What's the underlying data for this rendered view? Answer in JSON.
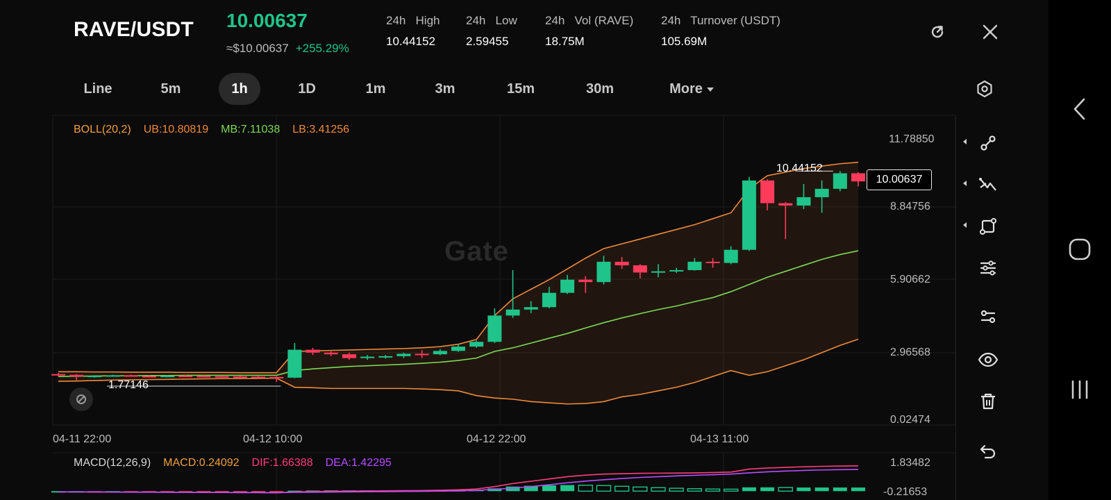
{
  "header": {
    "pair": "RAVE/USDT",
    "price": "10.00637",
    "usd_price": "≈$10.00637",
    "change": "+255.29%",
    "stats": [
      {
        "label": "24h   High",
        "value": "10.44152"
      },
      {
        "label": "24h   Low",
        "value": "2.59455"
      },
      {
        "label": "24h   Vol (RAVE)",
        "value": "18.75M"
      },
      {
        "label": "24h   Turnover (USDT)",
        "value": "105.69M"
      }
    ],
    "icons": [
      "refresh-icon",
      "close-icon"
    ]
  },
  "intervals": {
    "items": [
      "Line",
      "5m",
      "1h",
      "1D",
      "1m",
      "3m",
      "15m",
      "30m",
      "More"
    ],
    "active": "1h",
    "settings_icon": "settings-hex-icon"
  },
  "boll": {
    "label": "BOLL(20,2)",
    "ub": "UB:10.80819",
    "mb": "MB:7.11038",
    "lb": "LB:3.41256",
    "colors": {
      "label": "#f0a040",
      "ub": "#f08a3c",
      "mb": "#7ed957",
      "lb": "#f08a3c"
    }
  },
  "price_axis": [
    "11.78850",
    "8.84756",
    "5.90662",
    "2.96568",
    "0.02474"
  ],
  "time_axis": [
    "04-11 22:00",
    "04-12 10:00",
    "04-12 22:00",
    "04-13 11:00"
  ],
  "markers": {
    "high": "10.44152",
    "low": "1.77146",
    "last": "10.00637"
  },
  "watermark": "Gate",
  "macd": {
    "label": "MACD(12,26,9)",
    "macd": "MACD:0.24092",
    "dif": "DIF:1.66388",
    "dea": "DEA:1.42295",
    "axis": [
      "1.83482",
      "-0.21653"
    ],
    "colors": {
      "macd": "#f0a040",
      "dif": "#ff3d7f",
      "dea": "#b84dff"
    }
  },
  "toolbar": {
    "tools": [
      "trend-line-icon",
      "crossing-lines-icon",
      "shape-icon",
      "settings-sliders-icon",
      "indicator-icon",
      "eye-icon",
      "trash-icon",
      "undo-icon"
    ]
  },
  "system_nav": [
    "back-icon",
    "home-icon",
    "recents-icon"
  ],
  "colors": {
    "up": "#1fc48a",
    "down": "#ff3b5c",
    "bg": "#0b0b0b"
  },
  "chart_data": {
    "type": "candlestick",
    "interval": "1h",
    "y_range": [
      0.02474,
      11.7885
    ],
    "candles": [
      {
        "o": 1.95,
        "h": 2.0,
        "l": 1.85,
        "c": 1.92
      },
      {
        "o": 1.92,
        "h": 1.95,
        "l": 1.7,
        "c": 1.85
      },
      {
        "o": 1.85,
        "h": 1.9,
        "l": 1.8,
        "c": 1.88
      },
      {
        "o": 1.88,
        "h": 1.92,
        "l": 1.84,
        "c": 1.9
      },
      {
        "o": 1.9,
        "h": 1.93,
        "l": 1.85,
        "c": 1.87
      },
      {
        "o": 1.87,
        "h": 1.9,
        "l": 1.85,
        "c": 1.86
      },
      {
        "o": 1.86,
        "h": 1.9,
        "l": 1.82,
        "c": 1.88
      },
      {
        "o": 1.88,
        "h": 1.92,
        "l": 1.85,
        "c": 1.87
      },
      {
        "o": 1.87,
        "h": 1.9,
        "l": 1.82,
        "c": 1.86
      },
      {
        "o": 1.86,
        "h": 1.88,
        "l": 1.84,
        "c": 1.85
      },
      {
        "o": 1.85,
        "h": 1.88,
        "l": 1.82,
        "c": 1.84
      },
      {
        "o": 1.84,
        "h": 1.87,
        "l": 1.8,
        "c": 1.83
      },
      {
        "o": 1.83,
        "h": 1.86,
        "l": 1.62,
        "c": 1.8
      },
      {
        "o": 1.8,
        "h": 3.25,
        "l": 1.78,
        "c": 2.97
      },
      {
        "o": 2.97,
        "h": 3.05,
        "l": 2.75,
        "c": 2.85
      },
      {
        "o": 2.85,
        "h": 2.9,
        "l": 2.7,
        "c": 2.78
      },
      {
        "o": 2.78,
        "h": 2.85,
        "l": 2.55,
        "c": 2.62
      },
      {
        "o": 2.62,
        "h": 2.75,
        "l": 2.55,
        "c": 2.68
      },
      {
        "o": 2.68,
        "h": 2.75,
        "l": 2.6,
        "c": 2.7
      },
      {
        "o": 2.7,
        "h": 2.85,
        "l": 2.62,
        "c": 2.8
      },
      {
        "o": 2.8,
        "h": 2.95,
        "l": 2.62,
        "c": 2.78
      },
      {
        "o": 2.78,
        "h": 3.0,
        "l": 2.74,
        "c": 2.92
      },
      {
        "o": 2.92,
        "h": 3.2,
        "l": 2.88,
        "c": 3.1
      },
      {
        "o": 3.1,
        "h": 3.35,
        "l": 3.05,
        "c": 3.3
      },
      {
        "o": 3.3,
        "h": 4.7,
        "l": 3.25,
        "c": 4.4
      },
      {
        "o": 4.4,
        "h": 6.3,
        "l": 4.3,
        "c": 4.65
      },
      {
        "o": 4.65,
        "h": 5.0,
        "l": 4.5,
        "c": 4.75
      },
      {
        "o": 4.75,
        "h": 5.6,
        "l": 4.7,
        "c": 5.35
      },
      {
        "o": 5.35,
        "h": 6.1,
        "l": 5.3,
        "c": 5.9
      },
      {
        "o": 5.9,
        "h": 6.05,
        "l": 5.35,
        "c": 5.8
      },
      {
        "o": 5.8,
        "h": 6.9,
        "l": 5.7,
        "c": 6.65
      },
      {
        "o": 6.65,
        "h": 6.85,
        "l": 6.35,
        "c": 6.5
      },
      {
        "o": 6.5,
        "h": 6.55,
        "l": 5.95,
        "c": 6.2
      },
      {
        "o": 6.2,
        "h": 6.55,
        "l": 6.0,
        "c": 6.25
      },
      {
        "o": 6.25,
        "h": 6.4,
        "l": 6.18,
        "c": 6.3
      },
      {
        "o": 6.3,
        "h": 6.8,
        "l": 6.28,
        "c": 6.65
      },
      {
        "o": 6.65,
        "h": 6.8,
        "l": 6.4,
        "c": 6.6
      },
      {
        "o": 6.6,
        "h": 7.3,
        "l": 6.55,
        "c": 7.15
      },
      {
        "o": 7.15,
        "h": 10.2,
        "l": 7.1,
        "c": 10.05
      },
      {
        "o": 10.05,
        "h": 10.1,
        "l": 8.8,
        "c": 9.1
      },
      {
        "o": 9.1,
        "h": 9.15,
        "l": 7.6,
        "c": 9.0
      },
      {
        "o": 9.0,
        "h": 9.9,
        "l": 8.85,
        "c": 9.35
      },
      {
        "o": 9.35,
        "h": 10.05,
        "l": 8.7,
        "c": 9.7
      },
      {
        "o": 9.7,
        "h": 10.44,
        "l": 9.6,
        "c": 10.35
      },
      {
        "o": 10.35,
        "h": 10.4,
        "l": 9.8,
        "c": 10.01
      }
    ],
    "boll_ub": [
      2.05,
      2.05,
      2.04,
      2.04,
      2.03,
      2.03,
      2.03,
      2.02,
      2.02,
      2.02,
      2.01,
      2.01,
      2.01,
      2.9,
      2.92,
      2.94,
      2.96,
      2.98,
      3.0,
      3.02,
      3.05,
      3.1,
      3.2,
      3.4,
      4.4,
      5.1,
      5.5,
      5.9,
      6.35,
      6.8,
      7.2,
      7.4,
      7.6,
      7.8,
      8.0,
      8.2,
      8.45,
      8.7,
      9.7,
      10.25,
      10.4,
      10.55,
      10.65,
      10.75,
      10.81
    ],
    "boll_mb": [
      1.85,
      1.86,
      1.87,
      1.88,
      1.88,
      1.89,
      1.89,
      1.9,
      1.9,
      1.9,
      1.9,
      1.9,
      1.9,
      2.1,
      2.17,
      2.22,
      2.27,
      2.3,
      2.33,
      2.36,
      2.4,
      2.45,
      2.52,
      2.62,
      2.9,
      3.05,
      3.25,
      3.45,
      3.65,
      3.88,
      4.1,
      4.3,
      4.48,
      4.65,
      4.8,
      4.98,
      5.15,
      5.4,
      5.7,
      6.0,
      6.25,
      6.5,
      6.75,
      6.95,
      7.11
    ],
    "boll_lb": [
      1.65,
      1.66,
      1.68,
      1.7,
      1.71,
      1.72,
      1.73,
      1.74,
      1.75,
      1.76,
      1.76,
      1.77,
      1.78,
      1.4,
      1.38,
      1.35,
      1.35,
      1.35,
      1.35,
      1.35,
      1.33,
      1.3,
      1.25,
      1.05,
      0.95,
      0.9,
      0.8,
      0.75,
      0.7,
      0.72,
      0.8,
      1.0,
      1.1,
      1.25,
      1.4,
      1.6,
      1.85,
      2.1,
      1.9,
      2.05,
      2.3,
      2.55,
      2.85,
      3.15,
      3.41
    ],
    "macd_dif": [
      -0.05,
      -0.05,
      -0.06,
      -0.06,
      -0.07,
      -0.07,
      -0.08,
      -0.08,
      -0.09,
      -0.09,
      -0.1,
      -0.1,
      -0.11,
      -0.05,
      -0.03,
      -0.01,
      0.0,
      0.01,
      0.02,
      0.03,
      0.04,
      0.06,
      0.09,
      0.14,
      0.3,
      0.5,
      0.65,
      0.8,
      0.95,
      1.05,
      1.12,
      1.15,
      1.17,
      1.18,
      1.19,
      1.2,
      1.22,
      1.25,
      1.45,
      1.52,
      1.56,
      1.6,
      1.63,
      1.65,
      1.66
    ],
    "macd_dea": [
      -0.05,
      -0.05,
      -0.05,
      -0.06,
      -0.06,
      -0.06,
      -0.07,
      -0.07,
      -0.08,
      -0.08,
      -0.09,
      -0.09,
      -0.1,
      -0.08,
      -0.07,
      -0.06,
      -0.05,
      -0.04,
      -0.03,
      -0.02,
      -0.01,
      0.0,
      0.02,
      0.05,
      0.12,
      0.2,
      0.3,
      0.42,
      0.55,
      0.66,
      0.75,
      0.83,
      0.9,
      0.95,
      1.0,
      1.04,
      1.08,
      1.12,
      1.2,
      1.27,
      1.32,
      1.36,
      1.39,
      1.41,
      1.42
    ],
    "macd_hist": [
      0.0,
      0.0,
      -0.01,
      0.0,
      -0.01,
      -0.01,
      -0.01,
      -0.01,
      -0.01,
      -0.01,
      -0.01,
      -0.01,
      -0.01,
      0.03,
      0.04,
      0.05,
      0.05,
      0.05,
      0.05,
      0.05,
      0.05,
      0.06,
      0.07,
      0.09,
      0.18,
      0.3,
      0.35,
      0.38,
      0.4,
      0.39,
      0.37,
      0.32,
      0.27,
      0.23,
      0.19,
      0.16,
      0.14,
      0.13,
      0.25,
      0.25,
      0.24,
      0.24,
      0.24,
      0.24,
      0.24
    ]
  }
}
